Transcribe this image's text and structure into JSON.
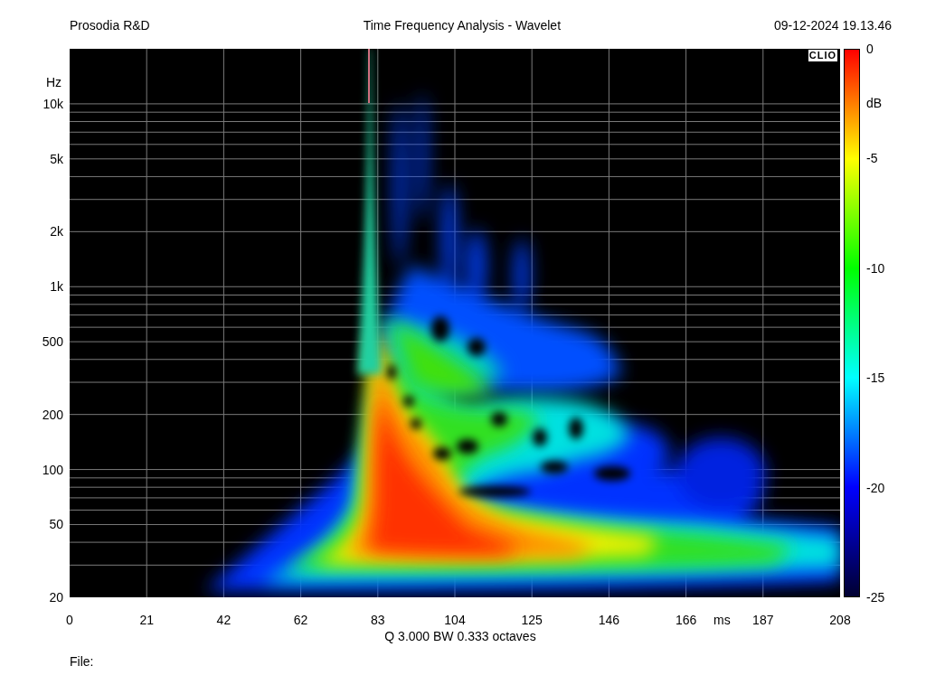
{
  "header": {
    "left": "Prosodia R&D",
    "title": "Time Frequency Analysis - Wavelet",
    "datetime": "09-12-2024 19.13.46"
  },
  "plot": {
    "logo": "CLIO",
    "y_unit": "Hz",
    "x_unit": "ms",
    "yticks": [
      "10k",
      "5k",
      "2k",
      "1k",
      "500",
      "200",
      "100",
      "50",
      "20"
    ],
    "xticks": [
      "0",
      "21",
      "42",
      "62",
      "83",
      "104",
      "125",
      "146",
      "166",
      "187",
      "208"
    ],
    "caption": "Q 3.000 BW 0.333 octaves"
  },
  "colorbar": {
    "unit": "dB",
    "ticks": [
      "0",
      "-5",
      "-10",
      "-15",
      "-20",
      "-25"
    ]
  },
  "footer": {
    "file_label": "File:"
  }
}
